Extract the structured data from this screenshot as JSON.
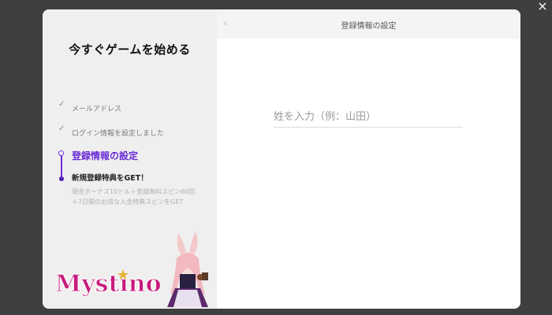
{
  "close_icon": "×",
  "left_panel": {
    "title": "今すぐゲームを始める",
    "steps": [
      {
        "label": "メールアドレス",
        "state": "done",
        "icon": "check-icon"
      },
      {
        "label": "ログイン情報を設定しました",
        "state": "done",
        "icon": "check-icon"
      },
      {
        "label": "登録情報の設定",
        "state": "current"
      },
      {
        "label": "新規登録特典をGET！",
        "state": "pending",
        "description": "現金ボーナス10ドル＋登録無料スピン60回＋7日間のお得な入金特典スピンをGET"
      }
    ],
    "logo_text": "Mystino",
    "colors": {
      "accent": "#6a2cd6",
      "logo": "#c81a7d"
    }
  },
  "right_panel": {
    "header_title": "登録情報の設定",
    "back_icon": "‹",
    "lastname_placeholder": "姓を入力（例：山田）"
  }
}
